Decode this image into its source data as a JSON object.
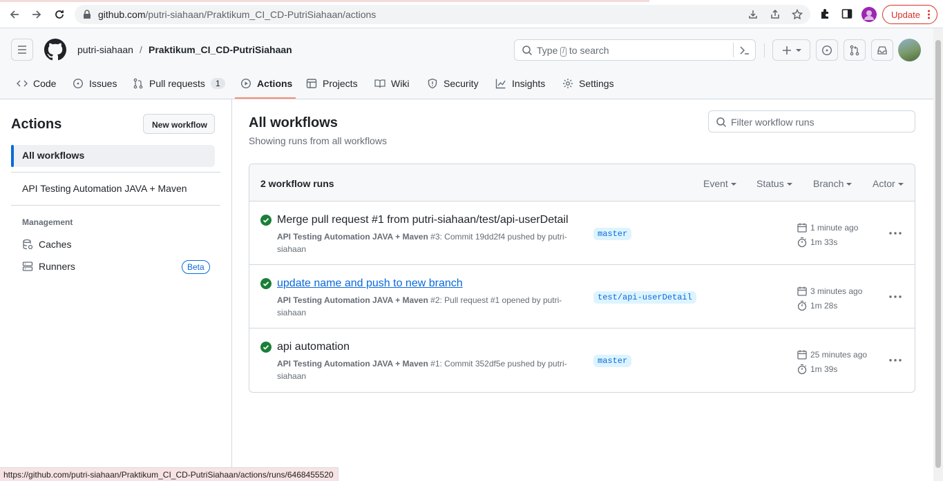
{
  "browser": {
    "url_host": "github.com",
    "url_path": "/putri-siahaan/Praktikum_CI_CD-PutriSiahaan/actions",
    "update_label": "Update",
    "status_url": "https://github.com/putri-siahaan/Praktikum_CI_CD-PutriSiahaan/actions/runs/6468455520"
  },
  "header": {
    "owner": "putri-siahaan",
    "separator": "/",
    "repo": "Praktikum_CI_CD-PutriSiahaan",
    "search_prefix": "Type",
    "search_key": "/",
    "search_suffix": "to search"
  },
  "tabs": [
    {
      "label": "Code"
    },
    {
      "label": "Issues"
    },
    {
      "label": "Pull requests",
      "count": "1"
    },
    {
      "label": "Actions"
    },
    {
      "label": "Projects"
    },
    {
      "label": "Wiki"
    },
    {
      "label": "Security"
    },
    {
      "label": "Insights"
    },
    {
      "label": "Settings"
    }
  ],
  "sidebar": {
    "title": "Actions",
    "new_workflow": "New workflow",
    "all_workflows": "All workflows",
    "workflow": "API Testing Automation JAVA + Maven",
    "management_heading": "Management",
    "caches": "Caches",
    "runners": "Runners",
    "beta": "Beta"
  },
  "main": {
    "title": "All workflows",
    "subtitle": "Showing runs from all workflows",
    "filter_placeholder": "Filter workflow runs",
    "runs_count": "2 workflow runs",
    "filters": [
      "Event",
      "Status",
      "Branch",
      "Actor"
    ],
    "runs": [
      {
        "title": "Merge pull request #1 from putri-siahaan/test/api-userDetail",
        "workflow": "API Testing Automation JAVA + Maven",
        "detail": "#3: Commit 19dd2f4 pushed by putri-siahaan",
        "branch": "master",
        "time": "1 minute ago",
        "duration": "1m 33s"
      },
      {
        "title": "update name and push to new branch",
        "workflow": "API Testing Automation JAVA + Maven",
        "detail": "#2: Pull request #1 opened by putri-siahaan",
        "branch": "test/api-userDetail",
        "time": "3 minutes ago",
        "duration": "1m 28s"
      },
      {
        "title": "api automation",
        "workflow": "API Testing Automation JAVA + Maven",
        "detail": "#1: Commit 352df5e pushed by putri-siahaan",
        "branch": "master",
        "time": "25 minutes ago",
        "duration": "1m 39s"
      }
    ]
  }
}
